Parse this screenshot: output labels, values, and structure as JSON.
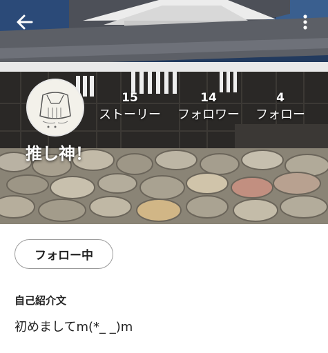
{
  "header": {
    "back_icon": "arrow-left-icon",
    "menu_icon": "more-vertical-icon"
  },
  "profile": {
    "username": "推し神！",
    "stats": [
      {
        "value": "15",
        "label": "ストーリー"
      },
      {
        "value": "14",
        "label": "フォロワー"
      },
      {
        "value": "4",
        "label": "フォロー"
      }
    ]
  },
  "actions": {
    "follow_label": "フォロー中"
  },
  "bio": {
    "heading": "自己紹介文",
    "text": "初めましてm(*_ _)m"
  },
  "colors": {
    "sky": "#223a5e",
    "wall": "#2a2826",
    "roof": "#5c5f66",
    "stone": "#a9a191",
    "accent_text": "#ffffff"
  }
}
